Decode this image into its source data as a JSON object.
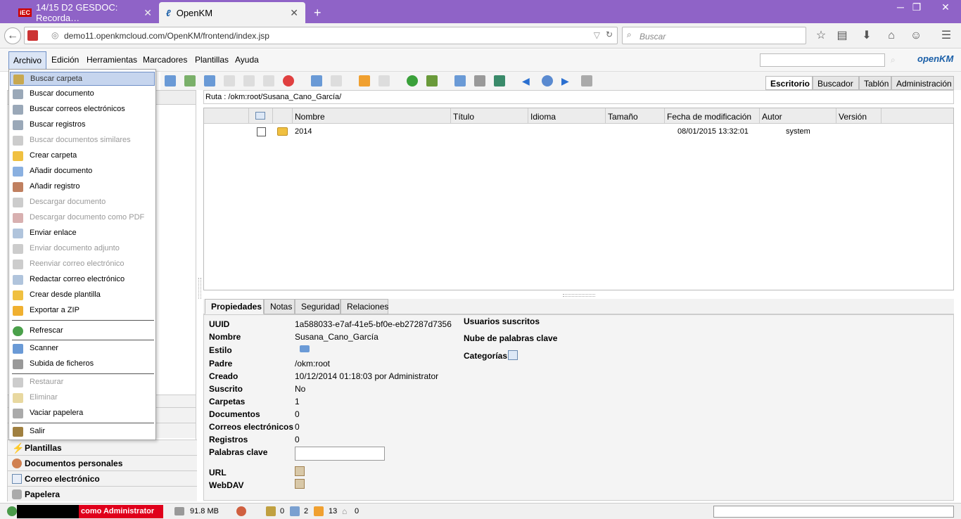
{
  "browser": {
    "tabs": [
      {
        "label": "14/15 D2 GESDOC: Recorda…",
        "badge": "iEC"
      },
      {
        "label": "OpenKM"
      }
    ],
    "new_tab": "+",
    "url": "demo11.openkmcloud.com/OpenKM/frontend/index.jsp",
    "search_placeholder": "Buscar"
  },
  "menubar": {
    "items": [
      "Archivo",
      "Edición",
      "Herramientas",
      "Marcadores",
      "Plantillas",
      "Ayuda"
    ],
    "logo": "openKM"
  },
  "right_tabs": [
    "Escritorio",
    "Buscador",
    "Tablón",
    "Administración"
  ],
  "path": "Ruta : /okm:root/Susana_Cano_García/",
  "grid": {
    "columns": [
      "Nombre",
      "Título",
      "Idioma",
      "Tamaño",
      "Fecha de modificación",
      "Autor",
      "Versión"
    ],
    "rows": [
      {
        "name": "2014",
        "date": "08/01/2015 13:32:01",
        "author": "system"
      }
    ]
  },
  "properties": {
    "tabs": [
      "Propiedades",
      "Notas",
      "Seguridad",
      "Relaciones"
    ],
    "fields": [
      {
        "label": "UUID",
        "value": "1a588033-e7af-41e5-bf0e-eb27287d7356"
      },
      {
        "label": "Nombre",
        "value": "Susana_Cano_García"
      },
      {
        "label": "Estilo",
        "value": ""
      },
      {
        "label": "Padre",
        "value": "/okm:root"
      },
      {
        "label": "Creado",
        "value": "10/12/2014 01:18:03 por Administrator"
      },
      {
        "label": "Suscrito",
        "value": "No"
      },
      {
        "label": "Carpetas",
        "value": "1"
      },
      {
        "label": "Documentos",
        "value": "0"
      },
      {
        "label": "Correos electrónicos",
        "value": "0"
      },
      {
        "label": "Registros",
        "value": "0"
      },
      {
        "label": "Palabras clave",
        "value": ""
      },
      {
        "label": "URL",
        "value": ""
      },
      {
        "label": "WebDAV",
        "value": ""
      }
    ],
    "right_labels": [
      "Usuarios suscritos",
      "Nube de palabras clave",
      "Categorías"
    ]
  },
  "left_stack": [
    "Plantillas",
    "Documentos personales",
    "Correo electrónico",
    "Papelera"
  ],
  "dropdown": [
    {
      "label": "Buscar carpeta",
      "state": "selected"
    },
    {
      "label": "Buscar documento",
      "state": "enabled"
    },
    {
      "label": "Buscar correos electrónicos",
      "state": "enabled"
    },
    {
      "label": "Buscar registros",
      "state": "enabled"
    },
    {
      "label": "Buscar documentos similares",
      "state": "disabled"
    },
    {
      "label": "Crear carpeta",
      "state": "enabled"
    },
    {
      "label": "Añadir documento",
      "state": "enabled"
    },
    {
      "label": "Añadir registro",
      "state": "enabled"
    },
    {
      "label": "Descargar documento",
      "state": "disabled"
    },
    {
      "label": "Descargar documento como PDF",
      "state": "disabled"
    },
    {
      "label": "Enviar enlace",
      "state": "enabled"
    },
    {
      "label": "Enviar documento adjunto",
      "state": "disabled"
    },
    {
      "label": "Reenviar correo electrónico",
      "state": "disabled"
    },
    {
      "label": "Redactar correo electrónico",
      "state": "enabled"
    },
    {
      "label": "Crear desde plantilla",
      "state": "enabled"
    },
    {
      "label": "Exportar a ZIP",
      "state": "enabled"
    },
    {
      "label": "Refrescar",
      "state": "enabled"
    },
    {
      "label": "Scanner",
      "state": "enabled"
    },
    {
      "label": "Subida de ficheros",
      "state": "enabled"
    },
    {
      "label": "Restaurar",
      "state": "disabled"
    },
    {
      "label": "Eliminar",
      "state": "disabled"
    },
    {
      "label": "Vaciar papelera",
      "state": "enabled"
    },
    {
      "label": "Salir",
      "state": "enabled"
    }
  ],
  "status": {
    "user": "como Administrator",
    "memory": "91.8 MB",
    "counts": [
      "0",
      "2",
      "13",
      "0"
    ]
  },
  "colors": {
    "titlebar": "#8f63c7",
    "user_badge": "#e0001b",
    "selection": "#c6d5ee"
  }
}
